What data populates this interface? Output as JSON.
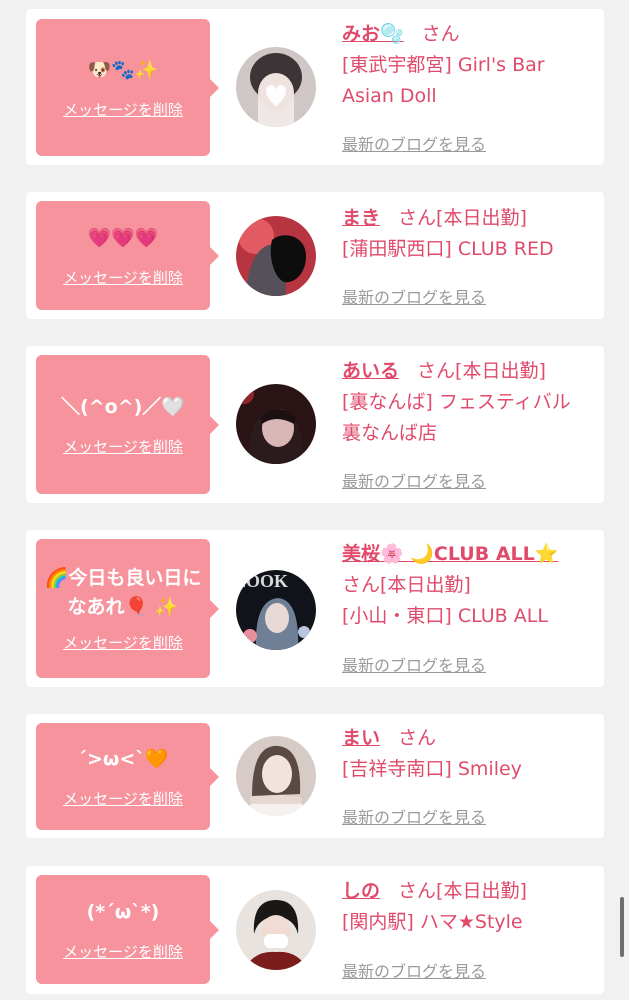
{
  "delete_label": "メッセージを削除",
  "blog_label": "最新のブログを見る",
  "san_label": "さん",
  "cards": [
    {
      "message": "🐶🐾✨",
      "name": "みお🫧",
      "after_name": "",
      "shop_lines": [
        "[東武宇都宮] Girl's Bar",
        "Asian Doll"
      ]
    },
    {
      "message": "💗💗💗",
      "name": "まき",
      "after_name": "[本日出勤]",
      "shop_lines": [
        "[蒲田駅西口] CLUB RED"
      ]
    },
    {
      "message": "＼(^o^)／🤍",
      "name": "あいる",
      "after_name": "[本日出勤]",
      "shop_lines": [
        "[裏なんば] フェスティバル",
        "裏なんば店"
      ]
    },
    {
      "message_lines": [
        "🌈今日も良い日に",
        "なあれ🎈 ✨"
      ],
      "name": "美桜🌸 🌙CLUB ALL⭐",
      "after_name": "",
      "second_line": "[本日出勤]",
      "shop_lines": [
        "[小山・東口] CLUB ALL"
      ],
      "avatar_text": "LOOK"
    },
    {
      "message": "´>ω<`🧡",
      "name": "まい",
      "after_name": "",
      "shop_lines": [
        "[吉祥寺南口] Smiley"
      ]
    },
    {
      "message": "(*´ω`*)",
      "name": "しの",
      "after_name": "[本日出勤]",
      "shop_lines": [
        "[関内駅] ハマ★Style"
      ]
    }
  ]
}
